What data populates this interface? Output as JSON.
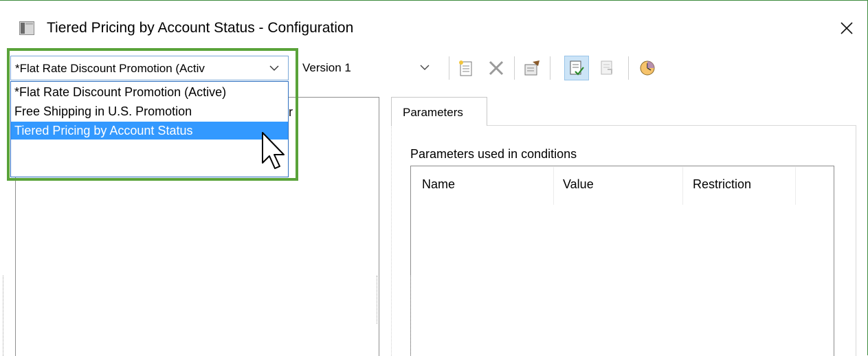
{
  "window": {
    "title": "Tiered Pricing by Account Status - Configuration"
  },
  "toolbar": {
    "combo_value": "*Flat Rate Discount Promotion (Activ",
    "version_value": "Version 1",
    "buttons": [
      "new-document-icon",
      "delete-icon",
      "properties-icon",
      "checked-document-icon",
      "disabled-document-icon",
      "clock-icon"
    ]
  },
  "dropdown": {
    "items": [
      "*Flat Rate Discount Promotion (Active)",
      "Free Shipping in U.S. Promotion",
      "Tiered Pricing by Account Status"
    ],
    "selected_index": 2
  },
  "left_panel": {
    "visible_fragment": "r"
  },
  "tabs": [
    {
      "label": "Parameters"
    }
  ],
  "parameters": {
    "group_label": "Parameters used in conditions",
    "columns": [
      "Name",
      "Value",
      "Restriction"
    ]
  },
  "colors": {
    "highlight_frame": "#5aa33a",
    "selection": "#3399ff",
    "window_border": "#3c8a3c"
  }
}
